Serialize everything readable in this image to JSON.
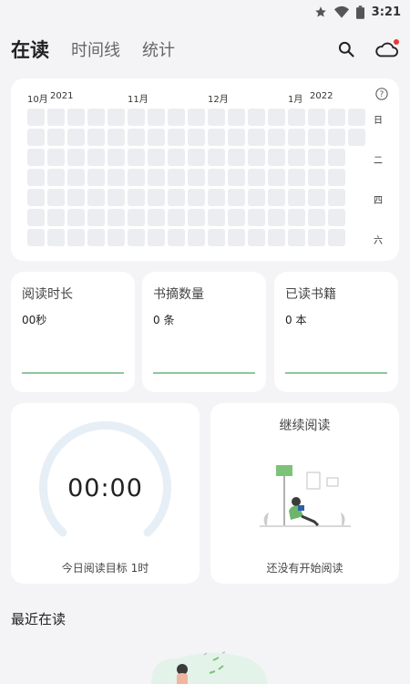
{
  "status_bar": {
    "time": "3:21",
    "icons": [
      "star-icon",
      "wifi-icon",
      "battery-icon"
    ]
  },
  "header": {
    "tabs": [
      {
        "label": "在读",
        "active": true
      },
      {
        "label": "时间线",
        "active": false
      },
      {
        "label": "统计",
        "active": false
      }
    ],
    "icons": [
      "search-icon",
      "cloud-icon"
    ]
  },
  "heatmap": {
    "months": [
      "10月",
      "2021",
      "11月",
      "12月",
      "1月",
      "2022"
    ],
    "weekdays": [
      "日",
      "二",
      "四",
      "六"
    ],
    "help_icon": "question-circle-icon"
  },
  "stats": [
    {
      "label": "阅读时长",
      "value": "00秒"
    },
    {
      "label": "书摘数量",
      "value": "0 条"
    },
    {
      "label": "已读书籍",
      "value": "0 本"
    }
  ],
  "timer": {
    "time": "00:00",
    "goal": "今日阅读目标 1时"
  },
  "continue_reading": {
    "title": "继续阅读",
    "empty_text": "还没有开始阅读"
  },
  "recent": {
    "title": "最近在读"
  },
  "colors": {
    "accent": "#8fc7a0",
    "ring": "#e6eef6",
    "cell": "#ebedf0",
    "notification": "#e53935"
  }
}
